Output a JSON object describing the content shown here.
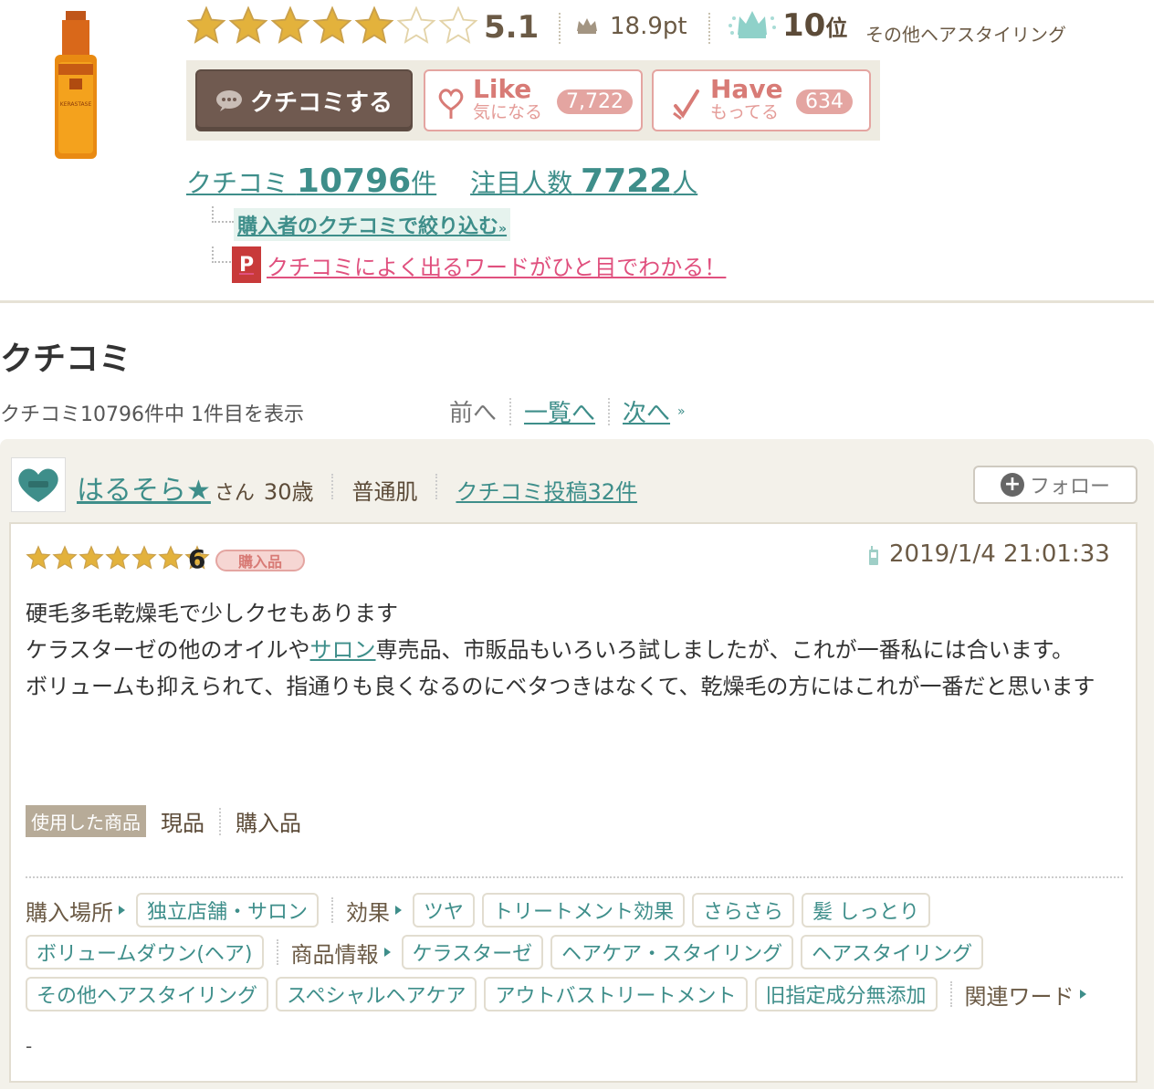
{
  "product": {
    "image_alt": "KERASTASE"
  },
  "rating": {
    "stars_filled": 5,
    "stars_total": 7,
    "score": "5.1",
    "points": "18.9pt",
    "rank": "10",
    "rank_unit": "位",
    "category": "その他ヘアスタイリング"
  },
  "actions": {
    "review_button": "クチコミする",
    "like": {
      "main": "Like",
      "sub": "気になる",
      "count": "7,722"
    },
    "have": {
      "main": "Have",
      "sub": "もってる",
      "count": "634"
    }
  },
  "counts": {
    "review_label": "クチコミ",
    "review_num": "10796",
    "review_unit": "件",
    "watch_label": "注目人数",
    "watch_num": "7722",
    "watch_unit": "人"
  },
  "links": {
    "filter": "購入者のクチコミで絞り込む",
    "filter_suffix": "»",
    "words": "クチコミによく出るワードがひと目でわかる！",
    "p_icon": "P"
  },
  "section": {
    "title": "クチコミ",
    "paging_info": "クチコミ10796件中 1件目を表示",
    "prev": "前へ",
    "list": "一覧へ",
    "next": "次へ",
    "next_suffix": "»"
  },
  "review": {
    "user": "はるそら★",
    "honorific": "さん",
    "age": "30歳",
    "skin": "普通肌",
    "posts": "クチコミ投稿32件",
    "follow": "フォロー",
    "stars": 7,
    "rating": "6",
    "badge": "購入品",
    "date": "2019/1/4 21:01:33",
    "body": {
      "line1": "硬毛多毛乾燥毛で少しクセもあります",
      "line2a": "ケラスターゼの他のオイルや",
      "line2link": "サロン",
      "line2b": "専売品、市販品もいろいろ試しましたが、これが一番私には合います。",
      "line3": "ボリュームも抑えられて、指通りも良くなるのにベタつきはなくて、乾燥毛の方にはこれが一番だと思います"
    },
    "used_label": "使用した商品",
    "used1": "現品",
    "used2": "購入品",
    "tag_groups": {
      "place_label": "購入場所",
      "place": [
        "独立店舗・サロン"
      ],
      "effect_label": "効果",
      "effect": [
        "ツヤ",
        "トリートメント効果",
        "さらさら",
        "髪 しっとり",
        "ボリュームダウン(ヘア)"
      ],
      "info_label": "商品情報",
      "info": [
        "ケラスターゼ",
        "ヘアケア・スタイリング",
        "ヘアスタイリング",
        "その他ヘアスタイリング",
        "スペシャルヘアケア",
        "アウトバストリートメント",
        "旧指定成分無添加"
      ],
      "related_label": "関連ワード"
    },
    "dash": "-"
  },
  "colors": {
    "accent": "#3e8e8a",
    "pink": "#d87b76",
    "star": "#e3b23c",
    "brown_button": "#705a50"
  }
}
